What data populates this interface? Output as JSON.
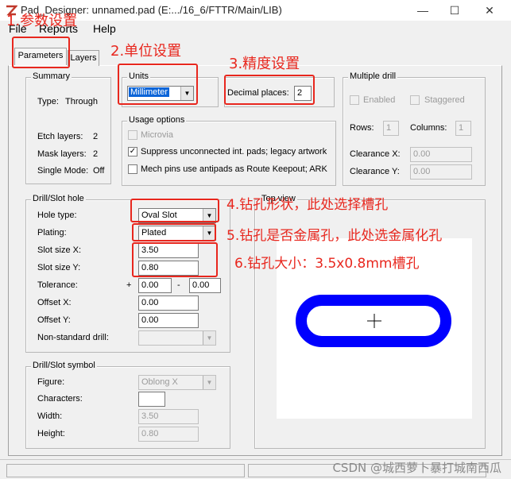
{
  "window": {
    "title": "Pad_Designer: unnamed.pad (E:.../16_6/FTTR/Main/LIB)",
    "minimize": "—",
    "maximize": "☐",
    "close": "✕"
  },
  "menu": [
    "File",
    "Reports",
    "Help"
  ],
  "tabs": [
    "Parameters",
    "Layers"
  ],
  "summary": {
    "title": "Summary",
    "type_label": "Type:",
    "type_value": "Through",
    "etch_label": "Etch layers:",
    "etch_value": "2",
    "mask_label": "Mask layers:",
    "mask_value": "2",
    "single_label": "Single Mode:",
    "single_value": "Off"
  },
  "units": {
    "title": "Units",
    "value": "Millimeter"
  },
  "decimal": {
    "label": "Decimal places:",
    "value": "2"
  },
  "usage": {
    "title": "Usage options",
    "microvia": "Microvia",
    "suppress": "Suppress unconnected int. pads; legacy artwork",
    "mechpins": "Mech pins use antipads as Route Keepout; ARK"
  },
  "multidrill": {
    "title": "Multiple drill",
    "enabled": "Enabled",
    "staggered": "Staggered",
    "rows_label": "Rows:",
    "rows_value": "1",
    "columns_label": "Columns:",
    "columns_value": "1",
    "clearx_label": "Clearance X:",
    "clearx_value": "0.00",
    "cleary_label": "Clearance Y:",
    "cleary_value": "0.00"
  },
  "drill": {
    "title": "Drill/Slot hole",
    "holetype_label": "Hole type:",
    "holetype_value": "Oval Slot",
    "plating_label": "Plating:",
    "plating_value": "Plated",
    "sizex_label": "Slot size X:",
    "sizex_value": "3.50",
    "sizey_label": "Slot size Y:",
    "sizey_value": "0.80",
    "tol_label": "Tolerance:",
    "tol_plus": "+",
    "tol_plus_value": "0.00",
    "tol_minus": "-",
    "tol_minus_value": "0.00",
    "offx_label": "Offset X:",
    "offx_value": "0.00",
    "offy_label": "Offset Y:",
    "offy_value": "0.00",
    "nonstd_label": "Non-standard drill:",
    "nonstd_value": ""
  },
  "symbol": {
    "title": "Drill/Slot symbol",
    "figure_label": "Figure:",
    "figure_value": "Oblong X",
    "chars_label": "Characters:",
    "chars_value": "",
    "width_label": "Width:",
    "width_value": "3.50",
    "height_label": "Height:",
    "height_value": "0.80"
  },
  "topview": {
    "title": "Top view",
    "slot_color": "#0000ff"
  },
  "annotations": {
    "a1": "1.参数设置",
    "a2": "2.单位设置",
    "a3": "3.精度设置",
    "a4": "4.钻孔形状，此处选择槽孔",
    "a5": "5.钻孔是否金属孔，此处选金属化孔",
    "a6": "6.钻孔大小：3.5x0.8mm槽孔",
    "color": "#e8271e"
  },
  "watermark": "CSDN @城西萝卜暴打城南西瓜"
}
